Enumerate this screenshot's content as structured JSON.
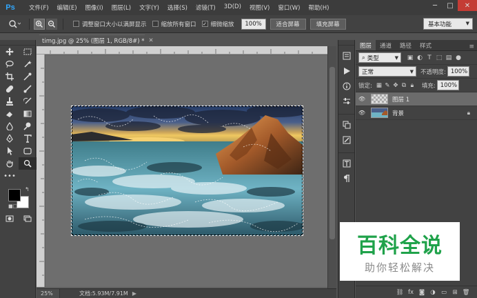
{
  "app": {
    "logo": "Ps"
  },
  "menu": [
    "文件(F)",
    "编辑(E)",
    "图像(I)",
    "图层(L)",
    "文字(Y)",
    "选择(S)",
    "滤镜(T)",
    "3D(D)",
    "视图(V)",
    "窗口(W)",
    "帮助(H)"
  ],
  "window_controls": {
    "minimize": "─",
    "maximize": "□",
    "close": "✕"
  },
  "options": {
    "resize_window_label": "调整窗口大小以满屏显示",
    "zoom_all_label": "缩放所有窗口",
    "scrubby_label": "细微缩放",
    "zoom_value": "100%",
    "fit_screen_label": "适合屏幕",
    "fill_screen_label": "填充屏幕",
    "workspace": "基本功能",
    "resize_checked": false,
    "zoom_all_checked": false,
    "scrubby_checked": true
  },
  "document": {
    "tab_title": "timg.jpg @ 25% (图层 1, RGB/8#) *",
    "zoom": "25%",
    "doc_info": "文档:5.93M/7.91M"
  },
  "colors": {
    "foreground": "#000000",
    "background": "#ffffff",
    "accent": "#31a8ff"
  },
  "layers_panel": {
    "tabs": [
      "图层",
      "通道",
      "路径",
      "样式"
    ],
    "filter_type": "类型",
    "blend_mode": "正常",
    "opacity_label": "不透明度:",
    "opacity_value": "100%",
    "lock_label": "锁定:",
    "fill_label": "填充:",
    "fill_value": "100%",
    "layers": [
      {
        "name": "图层 1",
        "active": true,
        "locked": false
      },
      {
        "name": "背景",
        "active": false,
        "locked": true
      }
    ]
  },
  "watermark": {
    "title": "百科全说",
    "subtitle": "助你轻松解决"
  }
}
